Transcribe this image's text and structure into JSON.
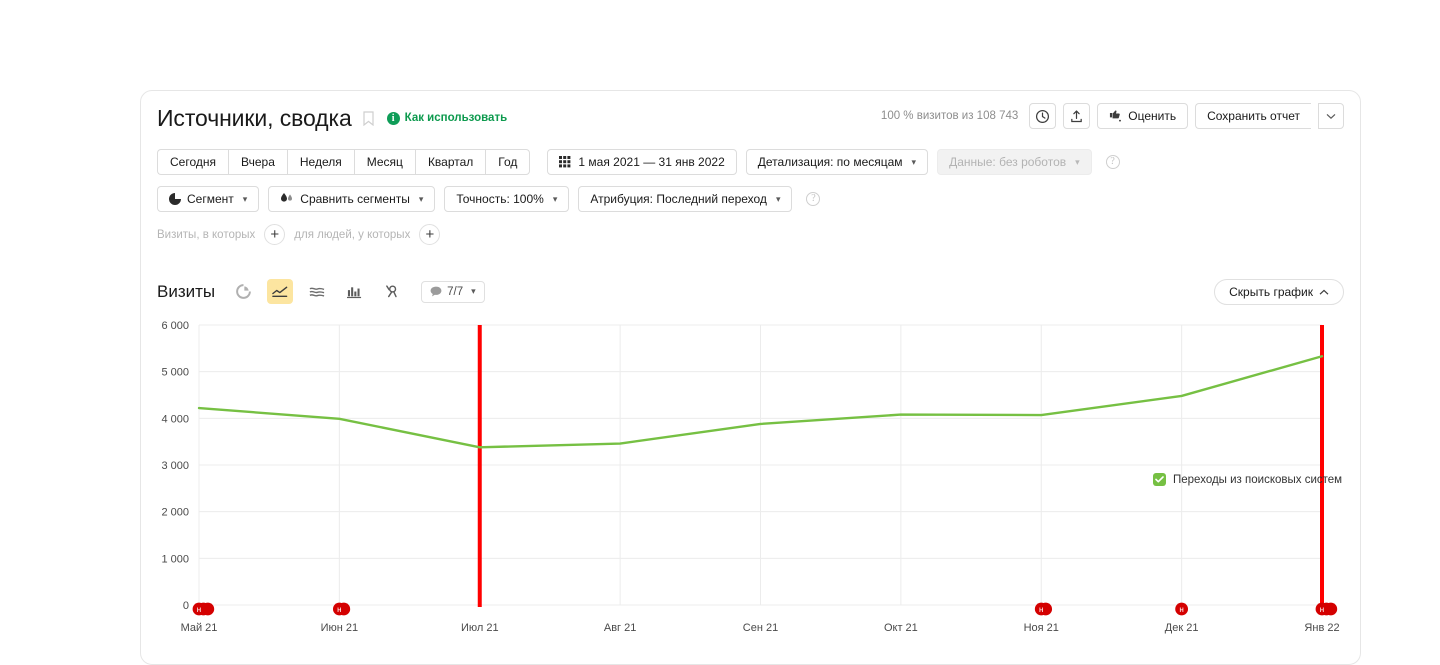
{
  "header": {
    "title": "Источники, сводка",
    "bookmark_icon": "bookmark-icon",
    "help_icon": "info-icon",
    "help_label": "Как использовать",
    "visits_summary": "100 % визитов из 108 743",
    "clock_icon": "clock-icon",
    "export_icon": "export-icon",
    "rate_icon": "thumbs-icon",
    "rate_label": "Оценить",
    "save_report_label": "Сохранить отчет",
    "save_report_caret": "chevron-down-icon"
  },
  "period_tabs": [
    "Сегодня",
    "Вчера",
    "Неделя",
    "Месяц",
    "Квартал",
    "Год"
  ],
  "toolbar_row1": {
    "calendar_icon": "calendar-icon",
    "date_range": "1 мая 2021 — 31 янв 2022",
    "detail_label": "Детализация: по месяцам",
    "data_label": "Данные: без роботов",
    "help_icon": "question-icon"
  },
  "toolbar_row2": {
    "segment_icon": "segment-pie-icon",
    "segment_label": "Сегмент",
    "compare_icon": "compare-drops-icon",
    "compare_label": "Сравнить сегменты",
    "accuracy_label": "Точность: 100%",
    "attribution_label": "Атрибуция: Последний переход",
    "help_icon": "question-icon"
  },
  "filter_row": {
    "visits_text": "Визиты, в которых",
    "add_visit_filter": "+",
    "people_text": "для людей, у которых",
    "add_people_filter": "+"
  },
  "chart_header": {
    "title": "Визиты",
    "view_types": [
      {
        "name": "pie-chart-icon",
        "active": false
      },
      {
        "name": "line-chart-icon",
        "active": true
      },
      {
        "name": "area-chart-icon",
        "active": false
      },
      {
        "name": "bar-chart-icon",
        "active": false
      },
      {
        "name": "map-chart-icon",
        "active": false
      }
    ],
    "annotations_icon": "comment-icon",
    "annotations_label": "7/7",
    "annotations_caret": "chevron-down-icon",
    "hide_chart_label": "Скрыть график",
    "hide_chart_caret": "chevron-up-icon"
  },
  "chart_data": {
    "type": "line",
    "title": "Визиты",
    "xlabel": "",
    "ylabel": "",
    "categories": [
      "Май 21",
      "Июн 21",
      "Июл 21",
      "Авг 21",
      "Сен 21",
      "Окт 21",
      "Ноя 21",
      "Дек 21",
      "Янв 22"
    ],
    "series": [
      {
        "name": "Переходы из поисковых систем",
        "color": "#76c043",
        "values": [
          4220,
          3990,
          3380,
          3460,
          3880,
          4080,
          4070,
          4480,
          5330
        ]
      }
    ],
    "ylim": [
      0,
      6000
    ],
    "yticks": [
      0,
      1000,
      2000,
      3000,
      4000,
      5000,
      6000
    ],
    "ytick_labels": [
      "0",
      "1 000",
      "2 000",
      "3 000",
      "4 000",
      "5 000",
      "6 000"
    ],
    "grid": true,
    "legend_position": "right",
    "annotations": [
      {
        "category": "Май 21",
        "count": 3,
        "badge": "н",
        "color": "#d40000"
      },
      {
        "category": "Июн 21",
        "count": 2,
        "badge": "н",
        "color": "#d40000"
      },
      {
        "category": "Ноя 21",
        "count": 2,
        "badge": "н",
        "color": "#d40000"
      },
      {
        "category": "Дек 21",
        "count": 1,
        "badge": "н",
        "color": "#d40000"
      },
      {
        "category": "Янв 22",
        "count": 3,
        "badge": "н",
        "color": "#d40000"
      }
    ],
    "vlines": [
      {
        "category": "Июл 21",
        "color": "#ff0000"
      },
      {
        "category": "Янв 22",
        "color": "#ff0000"
      }
    ]
  },
  "legend": {
    "check_icon": "check-icon",
    "label": "Переходы из поисковых систем",
    "color": "#76c043"
  }
}
